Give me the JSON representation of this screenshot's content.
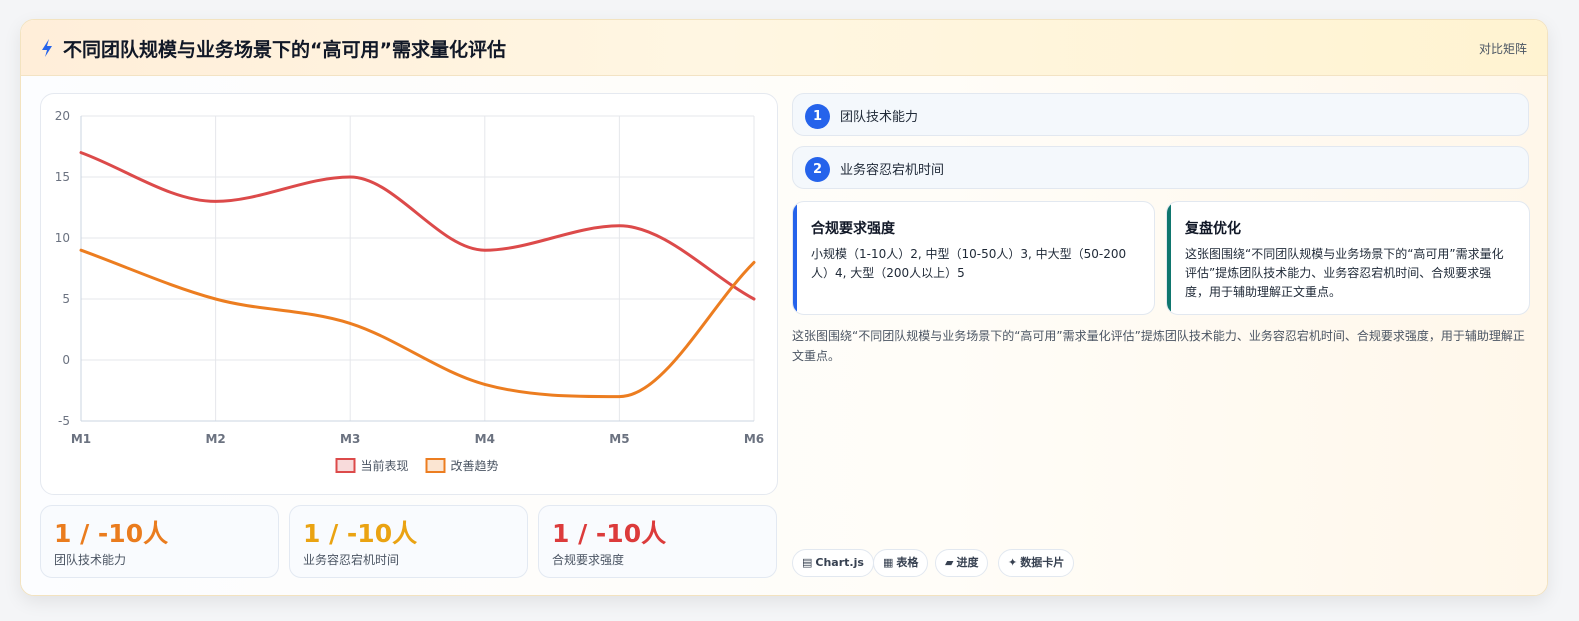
{
  "header": {
    "icon": "lightning-icon",
    "title": "不同团队规模与业务场景下的“高可用”需求量化评估",
    "action": "对比矩阵"
  },
  "chart_data": {
    "type": "line",
    "categories": [
      "M1",
      "M2",
      "M3",
      "M4",
      "M5",
      "M6"
    ],
    "series": [
      {
        "name": "当前表现",
        "values": [
          17,
          13,
          15,
          9,
          11,
          5
        ],
        "color": "#dc4a4a"
      },
      {
        "name": "改善趋势",
        "values": [
          9,
          5,
          3,
          -2,
          -3,
          8
        ],
        "color": "#ec7d20"
      }
    ],
    "ylim": [
      -5,
      20
    ],
    "yticks": [
      "20",
      "15",
      "10",
      "5",
      "0",
      "-5"
    ],
    "grid": true,
    "legend": "bottom"
  },
  "stats": [
    {
      "value": "1 / -10人",
      "label": "团队技术能力",
      "color": "#ea7c1e"
    },
    {
      "value": "1 / -10人",
      "label": "业务容忍宕机时间",
      "color": "#eaa312"
    },
    {
      "value": "1 / -10人",
      "label": "合规要求强度",
      "color": "#dc3b3b"
    }
  ],
  "steps": [
    {
      "num": "1",
      "label": "团队技术能力"
    },
    {
      "num": "2",
      "label": "业务容忍宕机时间"
    }
  ],
  "info_cards": [
    {
      "title": "合规要求强度",
      "body": "小规模（1-10人）2, 中型（10-50人）3, 中大型（50-200人）4, 大型（200人以上）5",
      "accent": "#2563eb"
    },
    {
      "title": "复盘优化",
      "body": "这张图围绕“不同团队规模与业务场景下的“高可用”需求量化评估”提炼团队技术能力、业务容忍宕机时间、合规要求强度，用于辅助理解正文重点。",
      "accent": "#0f766e"
    }
  ],
  "summary": "这张图围绕“不同团队规模与业务场景下的“高可用”需求量化评估”提炼团队技术能力、业务容忍宕机时间、合规要求强度，用于辅助理解正文重点。",
  "tags": [
    {
      "icon": "chart-icon",
      "glyph": "▤",
      "label": "Chart.js"
    },
    {
      "icon": "table-icon",
      "glyph": "▦",
      "label": "表格"
    },
    {
      "icon": "progress-icon",
      "glyph": "▰",
      "label": "进度"
    },
    {
      "icon": "sparkle-icon",
      "glyph": "✦",
      "label": "数据卡片"
    }
  ]
}
